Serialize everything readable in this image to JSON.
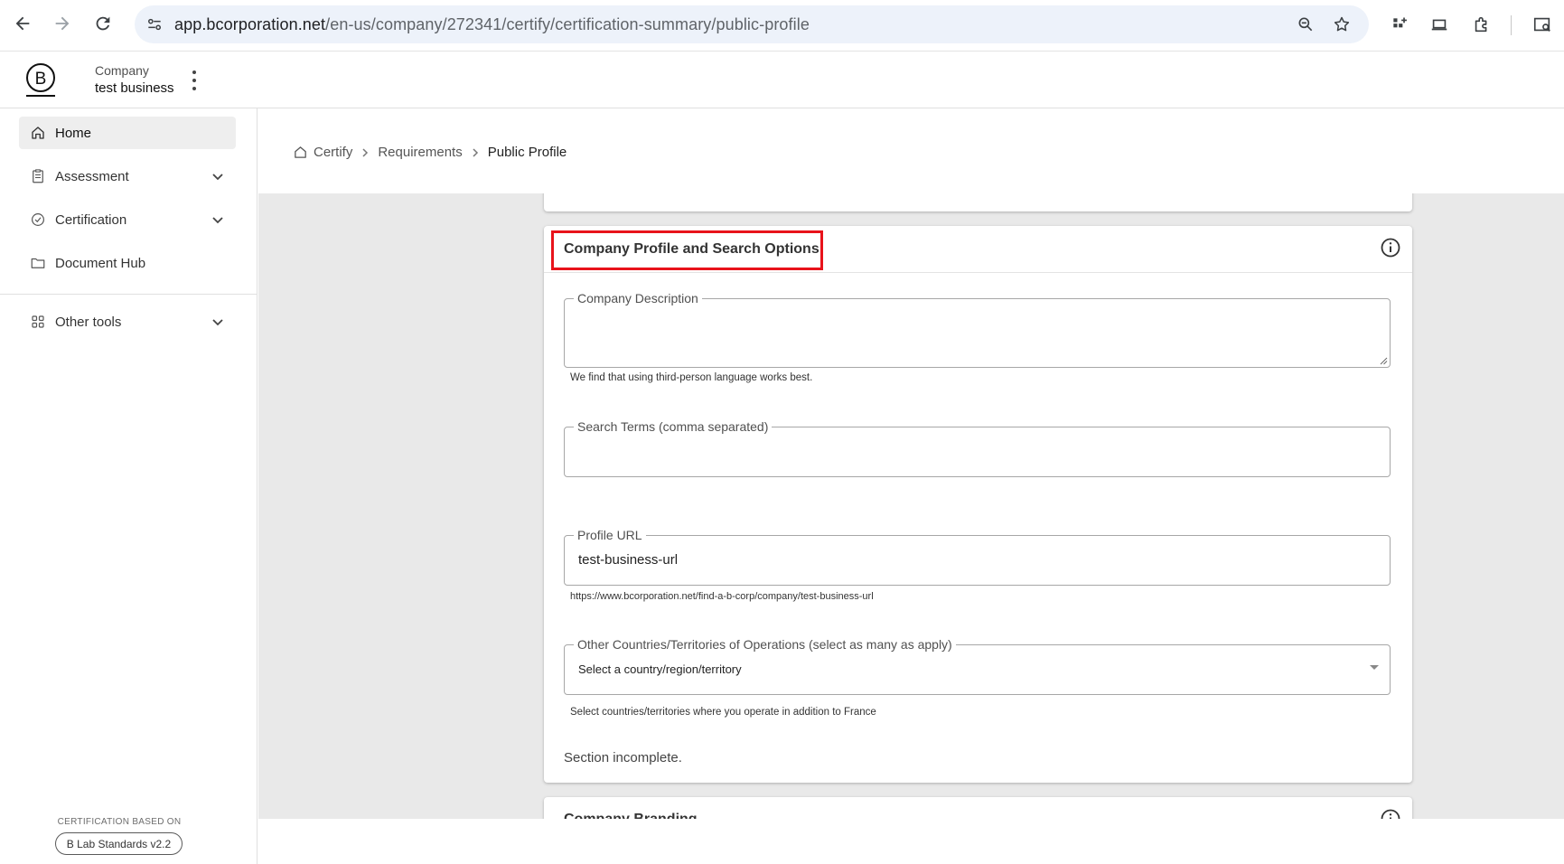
{
  "browser": {
    "url_host": "app.bcorporation.net",
    "url_path": "/en-us/company/272341/certify/certification-summary/public-profile"
  },
  "header": {
    "company_label": "Company",
    "company_name": "test business"
  },
  "sidebar": {
    "items": [
      {
        "label": "Home"
      },
      {
        "label": "Assessment"
      },
      {
        "label": "Certification"
      },
      {
        "label": "Document Hub"
      },
      {
        "label": "Other tools"
      }
    ],
    "footer_caption": "CERTIFICATION BASED ON",
    "standards_badge": "B Lab Standards v2.2"
  },
  "breadcrumb": {
    "items": [
      "Certify",
      "Requirements",
      "Public Profile"
    ]
  },
  "section": {
    "title": "Company Profile and Search Options",
    "description": {
      "label": "Company Description",
      "value": "",
      "helper": "We find that using third-person language works best."
    },
    "search_terms": {
      "label": "Search Terms (comma separated)",
      "value": ""
    },
    "profile_url": {
      "label": "Profile URL",
      "value": "test-business-url",
      "helper": "https://www.bcorporation.net/find-a-b-corp/company/test-business-url"
    },
    "countries": {
      "label": "Other Countries/Territories of Operations (select as many as apply)",
      "selected": "Select a country/region/territory",
      "helper": "Select countries/territories where you operate in addition to France"
    },
    "status": "Section incomplete."
  },
  "next_section": {
    "title": "Company Branding"
  },
  "colors": {
    "highlight": "#e8131b",
    "main_bg": "#e9e9e9",
    "active_nav": "#eeeeee"
  }
}
